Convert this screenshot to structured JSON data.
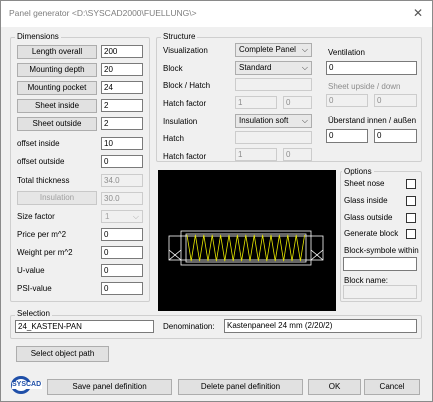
{
  "window": {
    "title": "Panel generator <D:\\SYSCAD2000\\FUELLUNG\\>",
    "close_glyph": "✕"
  },
  "dimensions": {
    "group_label": "Dimensions",
    "length_overall": {
      "label": "Length overall",
      "value": "200"
    },
    "mounting_depth": {
      "label": "Mounting depth",
      "value": "20"
    },
    "mounting_pocket": {
      "label": "Mounting pocket",
      "value": "24"
    },
    "sheet_inside": {
      "label": "Sheet inside",
      "value": "2"
    },
    "sheet_outside": {
      "label": "Sheet outside",
      "value": "2"
    },
    "offset_inside": {
      "label": "offset inside",
      "value": "10"
    },
    "offset_outside": {
      "label": "offset outside",
      "value": "0"
    },
    "total_thickness": {
      "label": "Total thickness",
      "value": "34.0"
    },
    "insulation": {
      "label": "Insulation",
      "value": "30.0"
    },
    "size_factor": {
      "label": "Size factor",
      "value": "1"
    },
    "price": {
      "label": "Price per m^2",
      "value": "0"
    },
    "weight": {
      "label": "Weight per m^2",
      "value": "0"
    },
    "u_value": {
      "label": "U-value",
      "value": "0"
    },
    "psi_value": {
      "label": "PSI-value",
      "value": "0"
    }
  },
  "structure": {
    "group_label": "Structure",
    "visualization": {
      "label": "Visualization",
      "value": "Complete Panel"
    },
    "block": {
      "label": "Block",
      "value": "Standard"
    },
    "block_hatch": {
      "label": "Block / Hatch",
      "value": ""
    },
    "hatch_factor_1": {
      "label": "Hatch factor",
      "value_a": "1",
      "value_b": "0"
    },
    "insulation": {
      "label": "Insulation",
      "value": "Insulation soft"
    },
    "hatch": {
      "label": "Hatch",
      "value": ""
    },
    "hatch_factor_2": {
      "label": "Hatch factor",
      "value_a": "1",
      "value_b": "0"
    }
  },
  "ventilation": {
    "label": "Ventilation",
    "value": "0",
    "sheet_updown_label": "Sheet upside / down",
    "sheet_updown_a": "0",
    "sheet_updown_b": "0",
    "overlap_label": "Überstand innen / außen",
    "overlap_a": "0",
    "overlap_b": "0"
  },
  "options": {
    "group_label": "Options",
    "items": [
      {
        "label": "Sheet nose"
      },
      {
        "label": "Glass inside"
      },
      {
        "label": "Glass outside"
      },
      {
        "label": "Generate block"
      }
    ],
    "block_symbol_label": "Block-symbole within",
    "block_symbol_value": "",
    "block_name_label": "Block name:",
    "block_name_value": ""
  },
  "selection": {
    "group_label": "Selection",
    "value": "24_KASTEN-PAN",
    "denomination_label": "Denomination:",
    "denomination_value": "Kastenpaneel 24 mm (2/20/2)"
  },
  "buttons": {
    "select_object_path": "Select object path",
    "save_panel": "Save panel definition",
    "delete_panel": "Delete panel definition",
    "ok": "OK",
    "cancel": "Cancel"
  },
  "logo": {
    "text": "SYSCAD"
  },
  "colors": {
    "preview_bg": "#000000",
    "preview_lines": "#ffffff",
    "insulation_zigzag": "#e6e600",
    "logo_blue": "#1f4fa8"
  }
}
